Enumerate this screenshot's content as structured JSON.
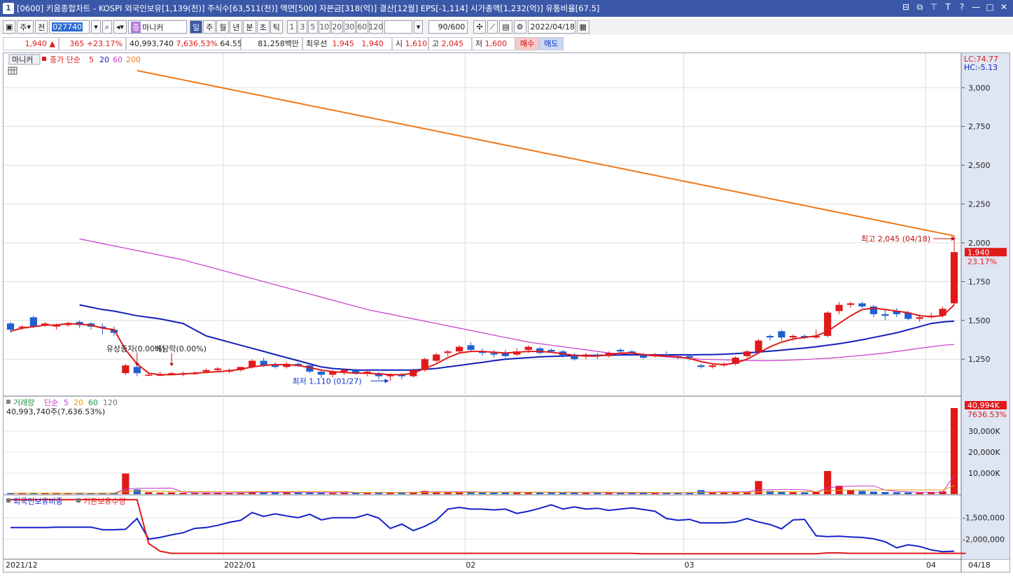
{
  "window": {
    "number": "1",
    "title": "[0600] 키움종합차트 - KOSPI 외국인보유[1,139(천)] 주식수[63,511(천)] 액면[500] 자본금[318(억)] 결산[12월] EPS[-1,114] 시가총액[1,232(억)] 유통비율[67.5]",
    "buttons": [
      "⊟",
      "⧉",
      "⊤",
      "T",
      "?",
      "—",
      "□",
      "✕"
    ]
  },
  "toolbar": {
    "period_type": "주",
    "prev_label": "전",
    "stock_code": "027740",
    "stock_name": "마니커",
    "ticks": [
      "일",
      "주",
      "월",
      "년",
      "분",
      "초",
      "틱"
    ],
    "active_tick": "일",
    "minute_options": [
      "1",
      "3",
      "5",
      "10",
      "20",
      "30",
      "60",
      "120"
    ],
    "count": "90/600",
    "date": "2022/04/18"
  },
  "quote": {
    "price": "1,940",
    "change": "365",
    "change_pct": "+23.17%",
    "volume": "40,993,740",
    "volume_pct": "7,636.53%",
    "ratio": "64.55%",
    "amount": "81,258백만",
    "best_ask_label": "최우선",
    "best_ask": "1,945",
    "best_bid": "1,940",
    "open_label": "시",
    "open": "1,610",
    "high_label": "고",
    "high": "2,045",
    "low_label": "저",
    "low": "1,600",
    "buy_label": "매수",
    "sell_label": "매도"
  },
  "legend": {
    "price": {
      "name": "마니커",
      "label": "종가 단순",
      "ma": [
        "5",
        "20",
        "60",
        "200"
      ]
    },
    "volume": {
      "name": "거래량",
      "label": "단순",
      "ma": [
        "5",
        "20",
        "60",
        "120"
      ],
      "current": "40,993,740주(7,636.53%)"
    },
    "foreign": {
      "name1": "외국인보유비중",
      "name2": "기관보유수량"
    }
  },
  "side": {
    "lc": "LC:74.77",
    "hc": "HC:-5.13",
    "price_tag": "1,940",
    "price_pct": "23.17%",
    "volume_tag": "40,994K",
    "volume_pct": "7636.53%"
  },
  "annotations": {
    "high": "최고 2,045 (04/18)",
    "low": "최저 1,110 (01/27)",
    "event1": "유상증자(0.00%)",
    "event2": "배당락(0.00%)"
  },
  "colors": {
    "up": "#e01919",
    "down": "#1f5fd0",
    "ma5": "#e01919",
    "ma20": "#1420b8",
    "ma60": "#c838c8",
    "ma200": "#f07818",
    "foreign": "#1420c8",
    "inst": "#e01919"
  },
  "chart_data": {
    "type": "candlestick",
    "y_ticks": [
      1250,
      1500,
      1750,
      2000,
      2250,
      2500,
      2750,
      3000
    ],
    "y_tick_labels": [
      "1,250",
      "1,500",
      "1,750",
      "2,000",
      "2,250",
      "2,500",
      "2,750",
      "3,000"
    ],
    "volume_ticks": [
      10000,
      20000,
      30000
    ],
    "volume_tick_labels": [
      "10,000K",
      "20,000K",
      "30,000K"
    ],
    "foreign_ticks": [
      -1500000,
      -2000000
    ],
    "foreign_tick_labels": [
      "-1,500,000",
      "-2,000,000"
    ],
    "x_labels": [
      "2021/12",
      "2022/01",
      "02",
      "03",
      "04"
    ],
    "x_label_index": [
      0,
      19,
      40,
      59,
      80
    ],
    "last_date_label": "04/18",
    "candles": [
      [
        1480,
        1490,
        1420,
        1440
      ],
      [
        1460,
        1470,
        1440,
        1460
      ],
      [
        1520,
        1530,
        1450,
        1460
      ],
      [
        1470,
        1490,
        1460,
        1480
      ],
      [
        1460,
        1480,
        1440,
        1470
      ],
      [
        1470,
        1490,
        1460,
        1480
      ],
      [
        1490,
        1500,
        1450,
        1470
      ],
      [
        1480,
        1490,
        1440,
        1460
      ],
      [
        1460,
        1480,
        1410,
        1450
      ],
      [
        1440,
        1460,
        1400,
        1420
      ],
      [
        1160,
        1220,
        1150,
        1210
      ],
      [
        1200,
        1210,
        1140,
        1160
      ],
      [
        1150,
        1160,
        1140,
        1150
      ],
      [
        1150,
        1170,
        1140,
        1150
      ],
      [
        1160,
        1170,
        1150,
        1160
      ],
      [
        1150,
        1170,
        1140,
        1160
      ],
      [
        1160,
        1170,
        1150,
        1160
      ],
      [
        1170,
        1190,
        1160,
        1180
      ],
      [
        1180,
        1200,
        1170,
        1190
      ],
      [
        1170,
        1190,
        1160,
        1180
      ],
      [
        1180,
        1200,
        1170,
        1200
      ],
      [
        1200,
        1250,
        1190,
        1240
      ],
      [
        1240,
        1260,
        1200,
        1210
      ],
      [
        1210,
        1230,
        1190,
        1200
      ],
      [
        1200,
        1230,
        1190,
        1220
      ],
      [
        1220,
        1230,
        1200,
        1210
      ],
      [
        1210,
        1220,
        1160,
        1170
      ],
      [
        1170,
        1180,
        1130,
        1150
      ],
      [
        1150,
        1180,
        1130,
        1170
      ],
      [
        1170,
        1190,
        1150,
        1180
      ],
      [
        1180,
        1190,
        1150,
        1160
      ],
      [
        1160,
        1180,
        1140,
        1170
      ],
      [
        1160,
        1170,
        1120,
        1140
      ],
      [
        1140,
        1160,
        1110,
        1150
      ],
      [
        1150,
        1160,
        1120,
        1140
      ],
      [
        1140,
        1190,
        1130,
        1180
      ],
      [
        1180,
        1260,
        1170,
        1250
      ],
      [
        1240,
        1290,
        1230,
        1280
      ],
      [
        1290,
        1310,
        1270,
        1300
      ],
      [
        1300,
        1340,
        1290,
        1330
      ],
      [
        1340,
        1360,
        1300,
        1310
      ],
      [
        1300,
        1320,
        1270,
        1290
      ],
      [
        1290,
        1310,
        1260,
        1280
      ],
      [
        1290,
        1310,
        1260,
        1270
      ],
      [
        1280,
        1320,
        1270,
        1300
      ],
      [
        1310,
        1340,
        1290,
        1330
      ],
      [
        1320,
        1330,
        1280,
        1290
      ],
      [
        1310,
        1320,
        1290,
        1300
      ],
      [
        1300,
        1310,
        1260,
        1270
      ],
      [
        1280,
        1290,
        1240,
        1250
      ],
      [
        1270,
        1290,
        1250,
        1280
      ],
      [
        1280,
        1290,
        1250,
        1270
      ],
      [
        1270,
        1300,
        1260,
        1290
      ],
      [
        1310,
        1320,
        1290,
        1300
      ],
      [
        1300,
        1310,
        1270,
        1290
      ],
      [
        1280,
        1290,
        1250,
        1260
      ],
      [
        1270,
        1290,
        1260,
        1280
      ],
      [
        1280,
        1300,
        1260,
        1270
      ],
      [
        1270,
        1280,
        1250,
        1260
      ],
      [
        1270,
        1280,
        1240,
        1260
      ],
      [
        1210,
        1220,
        1190,
        1200
      ],
      [
        1200,
        1220,
        1190,
        1210
      ],
      [
        1210,
        1230,
        1200,
        1220
      ],
      [
        1220,
        1270,
        1210,
        1260
      ],
      [
        1270,
        1310,
        1260,
        1300
      ],
      [
        1300,
        1380,
        1290,
        1370
      ],
      [
        1400,
        1410,
        1370,
        1390
      ],
      [
        1430,
        1440,
        1370,
        1390
      ],
      [
        1390,
        1410,
        1370,
        1400
      ],
      [
        1400,
        1410,
        1380,
        1390
      ],
      [
        1390,
        1440,
        1380,
        1400
      ],
      [
        1400,
        1560,
        1390,
        1550
      ],
      [
        1560,
        1620,
        1540,
        1600
      ],
      [
        1600,
        1620,
        1580,
        1610
      ],
      [
        1610,
        1620,
        1580,
        1590
      ],
      [
        1590,
        1600,
        1520,
        1540
      ],
      [
        1540,
        1570,
        1500,
        1530
      ],
      [
        1560,
        1580,
        1520,
        1540
      ],
      [
        1550,
        1560,
        1500,
        1510
      ],
      [
        1510,
        1540,
        1490,
        1520
      ],
      [
        1520,
        1550,
        1510,
        1530
      ],
      [
        1530,
        1590,
        1520,
        1575
      ],
      [
        1610,
        2045,
        1600,
        1940
      ]
    ],
    "ma5": [
      1430,
      1450,
      1460,
      1470,
      1470,
      1480,
      1475,
      1470,
      1450,
      1440,
      1310,
      1220,
      1160,
      1150,
      1150,
      1155,
      1160,
      1165,
      1170,
      1175,
      1185,
      1200,
      1210,
      1215,
      1215,
      1210,
      1195,
      1180,
      1170,
      1165,
      1160,
      1160,
      1155,
      1150,
      1150,
      1160,
      1190,
      1220,
      1260,
      1290,
      1300,
      1300,
      1295,
      1290,
      1295,
      1300,
      1300,
      1295,
      1285,
      1275,
      1270,
      1270,
      1280,
      1290,
      1290,
      1280,
      1275,
      1270,
      1265,
      1255,
      1235,
      1220,
      1215,
      1225,
      1250,
      1290,
      1330,
      1360,
      1380,
      1390,
      1400,
      1430,
      1480,
      1530,
      1570,
      1580,
      1570,
      1560,
      1550,
      1530,
      1525,
      1530,
      1600
    ],
    "ma20": [
      1600,
      1585,
      1570,
      1560,
      1545,
      1530,
      1520,
      1510,
      1495,
      1480,
      1440,
      1400,
      1380,
      1360,
      1340,
      1320,
      1300,
      1280,
      1260,
      1240,
      1220,
      1200,
      1190,
      1185,
      1180,
      1180,
      1180,
      1180,
      1180,
      1180,
      1185,
      1190,
      1200,
      1210,
      1220,
      1230,
      1240,
      1250,
      1255,
      1260,
      1265,
      1268,
      1270,
      1272,
      1274,
      1275,
      1276,
      1277,
      1278,
      1278,
      1278,
      1278,
      1278,
      1278,
      1279,
      1280,
      1282,
      1286,
      1290,
      1296,
      1302,
      1308,
      1315,
      1322,
      1330,
      1340,
      1350,
      1362,
      1375,
      1390,
      1405,
      1420,
      1440,
      1460,
      1480,
      1490,
      1495
    ],
    "ma20_offset": 0,
    "ma60": [
      2025,
      2010,
      1995,
      1980,
      1965,
      1950,
      1935,
      1920,
      1905,
      1890,
      1870,
      1850,
      1830,
      1810,
      1790,
      1770,
      1750,
      1730,
      1710,
      1690,
      1670,
      1650,
      1630,
      1610,
      1590,
      1570,
      1555,
      1540,
      1525,
      1510,
      1495,
      1480,
      1465,
      1450,
      1435,
      1420,
      1405,
      1390,
      1375,
      1360,
      1350,
      1340,
      1330,
      1320,
      1310,
      1300,
      1290,
      1285,
      1280,
      1275,
      1270,
      1265,
      1260,
      1255,
      1250,
      1248,
      1246,
      1244,
      1242,
      1240,
      1240,
      1242,
      1245,
      1248,
      1252,
      1256,
      1262,
      1268,
      1275,
      1282,
      1290,
      1300,
      1310,
      1320,
      1330,
      1340,
      1345
    ],
    "ma200": [
      3110,
      3095,
      3080,
      3065,
      3050,
      3035,
      3020,
      3005,
      2990,
      2975,
      2960,
      2945,
      2930,
      2915,
      2900,
      2885,
      2870,
      2855,
      2840,
      2825,
      2810,
      2795,
      2780,
      2765,
      2750,
      2735,
      2720,
      2705,
      2690,
      2675,
      2660,
      2645,
      2630,
      2615,
      2600,
      2585,
      2570,
      2555,
      2540,
      2525,
      2510,
      2495,
      2480,
      2465,
      2450,
      2435,
      2420,
      2405,
      2390,
      2375,
      2360,
      2345,
      2330,
      2315,
      2300,
      2285,
      2270,
      2255,
      2240,
      2225,
      2210,
      2195,
      2180,
      2165,
      2150,
      2135,
      2120,
      2105,
      2090,
      2075,
      2060,
      2045
    ],
    "volume": [
      500,
      400,
      600,
      450,
      400,
      380,
      420,
      480,
      520,
      600,
      9800,
      2200,
      900,
      700,
      800,
      600,
      500,
      600,
      700,
      650,
      800,
      1200,
      900,
      700,
      800,
      700,
      900,
      800,
      600,
      700,
      600,
      800,
      1000,
      900,
      700,
      900,
      1500,
      1200,
      1000,
      900,
      1100,
      800,
      900,
      1000,
      900,
      800,
      700,
      900,
      800,
      700,
      600,
      700,
      800,
      600,
      700,
      600,
      500,
      600,
      700,
      800,
      1900,
      1000,
      800,
      900,
      1100,
      6200,
      1500,
      1100,
      900,
      800,
      1000,
      11000,
      4000,
      2000,
      1500,
      1200,
      1000,
      900,
      800,
      700,
      900,
      1300,
      41000
    ],
    "foreign": [
      -1730000,
      -1730000,
      -1730000,
      -1730000,
      -1720000,
      -1720000,
      -1720000,
      -1720000,
      -1780000,
      -1780000,
      -1770000,
      -1520000,
      -2000000,
      -1960000,
      -1900000,
      -1850000,
      -1750000,
      -1730000,
      -1680000,
      -1610000,
      -1560000,
      -1380000,
      -1470000,
      -1410000,
      -1460000,
      -1500000,
      -1420000,
      -1550000,
      -1500000,
      -1500000,
      -1500000,
      -1420000,
      -1510000,
      -1750000,
      -1650000,
      -1800000,
      -1700000,
      -1560000,
      -1300000,
      -1260000,
      -1300000,
      -1300000,
      -1320000,
      -1300000,
      -1400000,
      -1350000,
      -1280000,
      -1200000,
      -1300000,
      -1250000,
      -1300000,
      -1280000,
      -1330000,
      -1300000,
      -1270000,
      -1310000,
      -1350000,
      -1520000,
      -1560000,
      -1540000,
      -1620000,
      -1620000,
      -1620000,
      -1600000,
      -1520000,
      -1600000,
      -1660000,
      -1760000,
      -1550000,
      -1540000,
      -1920000,
      -1940000,
      -1930000,
      -1950000,
      -1960000,
      -1990000,
      -2060000,
      -2200000,
      -2130000,
      -2170000,
      -2250000,
      -2290000,
      -2280000
    ],
    "institution": [
      -1080000,
      -1080000,
      -1080000,
      -1080000,
      -1080000,
      -1080000,
      -1080000,
      -1080000,
      -1080000,
      -1080000,
      -1080000,
      -1080000,
      -2100000,
      -2280000,
      -2330000,
      -2330000,
      -2330000,
      -2330000,
      -2330000,
      -2330000,
      -2330000,
      -2330000,
      -2330000,
      -2330000,
      -2330000,
      -2330000,
      -2330000,
      -2330000,
      -2330000,
      -2330000,
      -2330000,
      -2330000,
      -2330000,
      -2330000,
      -2330000,
      -2330000,
      -2330000,
      -2330000,
      -2330000,
      -2330000,
      -2330000,
      -2330000,
      -2330000,
      -2330000,
      -2330000,
      -2330000,
      -2330000,
      -2330000,
      -2330000,
      -2330000,
      -2330000,
      -2330000,
      -2330000,
      -2330000,
      -2330000,
      -2340000,
      -2340000,
      -2340000,
      -2340000,
      -2340000,
      -2340000,
      -2340000,
      -2340000,
      -2340000,
      -2340000,
      -2340000,
      -2340000,
      -2340000,
      -2340000,
      -2340000,
      -2340000,
      -2320000,
      -2320000,
      -2330000,
      -2330000,
      -2330000,
      -2330000,
      -2330000,
      -2330000,
      -2330000,
      -2330000,
      -2330000,
      -2330000,
      -2330000
    ]
  }
}
